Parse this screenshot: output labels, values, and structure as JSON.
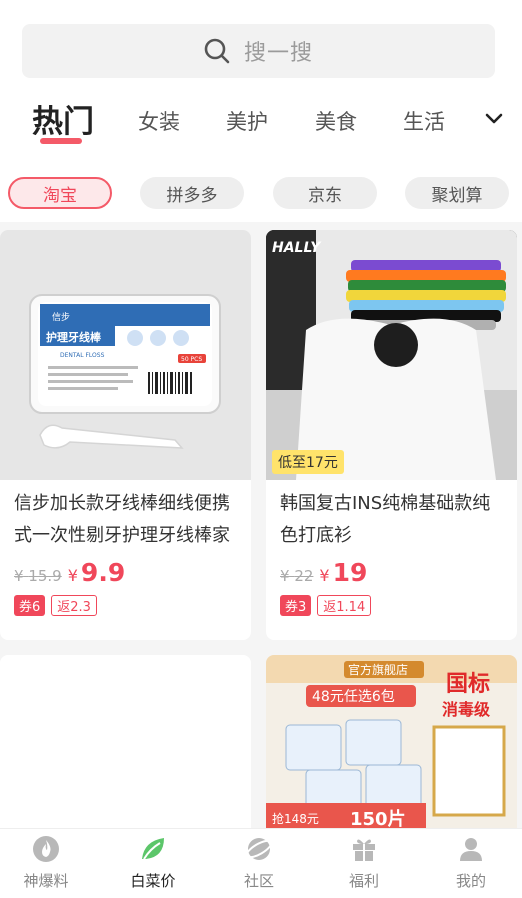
{
  "search": {
    "placeholder": "搜一搜",
    "icon": "search-icon"
  },
  "tabs": [
    {
      "label": "热门",
      "active": true
    },
    {
      "label": "女装"
    },
    {
      "label": "美护"
    },
    {
      "label": "美食"
    },
    {
      "label": "生活"
    }
  ],
  "platforms": [
    {
      "label": "淘宝",
      "active": true
    },
    {
      "label": "拼多多"
    },
    {
      "label": "京东"
    },
    {
      "label": "聚划算"
    }
  ],
  "products": [
    {
      "title": "信步加长款牙线棒细线便携式一次性剔牙护理牙线棒家",
      "currency": "¥",
      "old_price": "15.9",
      "price": "9.9",
      "coupon": "券6",
      "rebate": "返2.3",
      "image_text": {
        "brand": "信步",
        "name": "护理牙线棒",
        "sub": "DENTAL FLOSS",
        "count": "50 PCS"
      }
    },
    {
      "title": "韩国复古INS纯棉基础款纯色打底衫",
      "currency": "¥",
      "old_price": "22",
      "price": "19",
      "coupon": "券3",
      "rebate": "返1.14",
      "tag": "低至17元",
      "image_text": {
        "logo": "HALLY"
      }
    },
    {
      "title": "",
      "image_text": {}
    },
    {
      "title": "",
      "image_text": {
        "store": "官方旗舰店",
        "promo": "48元任选6包",
        "standard": "国标",
        "grade": "消毒级",
        "banner": "抢148元",
        "count": "150片"
      }
    }
  ],
  "tabbar": [
    {
      "label": "神爆料",
      "icon": "flame-icon"
    },
    {
      "label": "白菜价",
      "icon": "leaf-icon",
      "active": true
    },
    {
      "label": "社区",
      "icon": "planet-icon"
    },
    {
      "label": "福利",
      "icon": "gift-icon"
    },
    {
      "label": "我的",
      "icon": "user-icon"
    }
  ],
  "colors": {
    "accent": "#f45a68",
    "price": "#f0475a",
    "active_icon": "#5cc66a"
  }
}
